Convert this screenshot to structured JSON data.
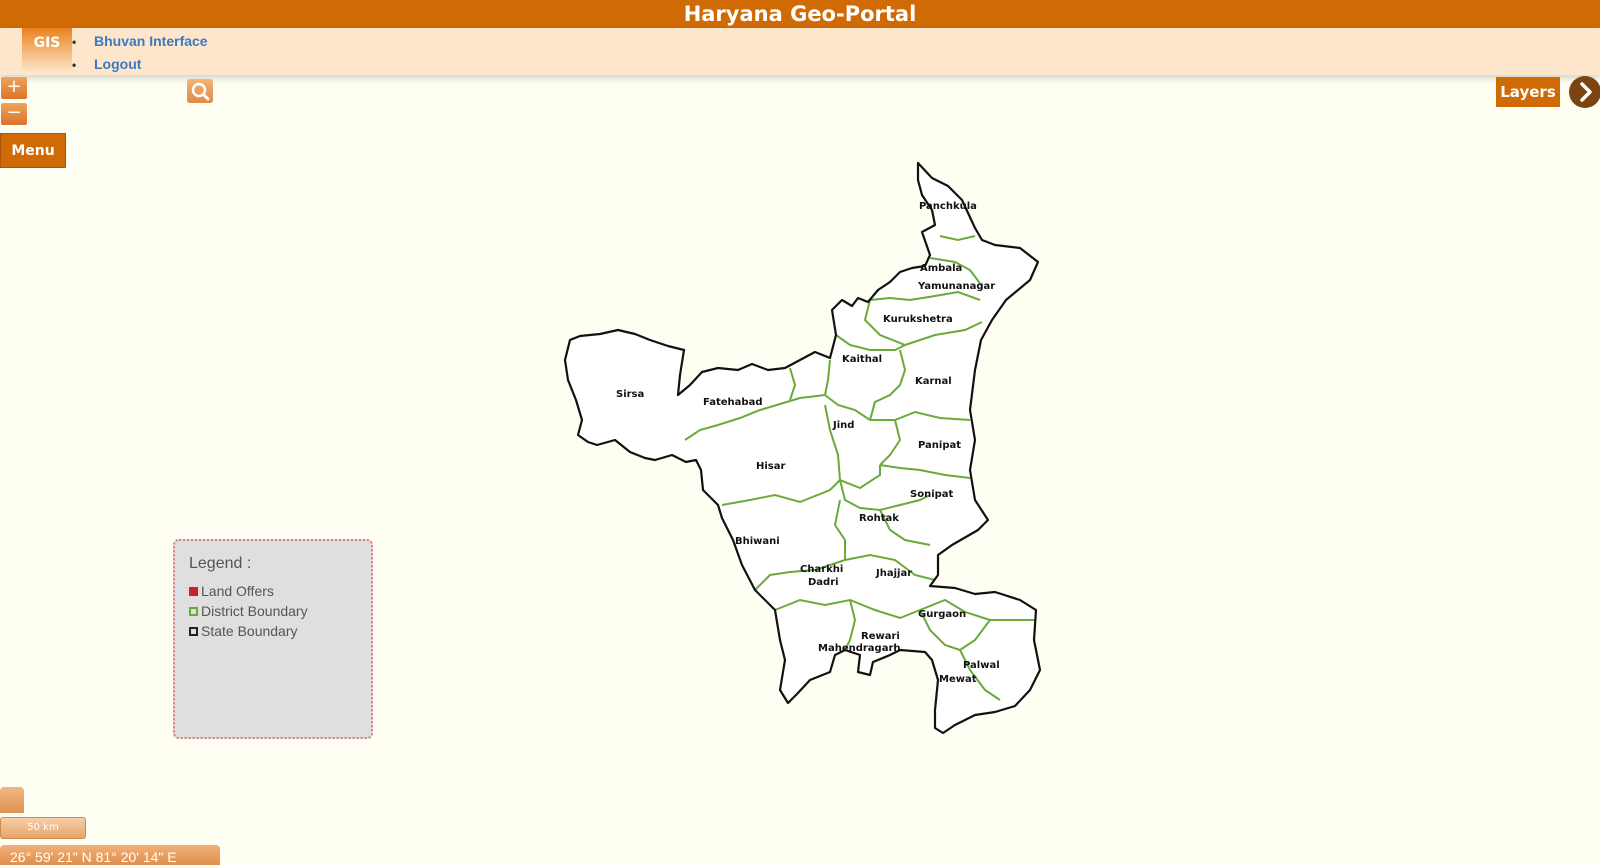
{
  "header": {
    "title": "Haryana Geo-Portal"
  },
  "nav": {
    "gis_label": "GIS",
    "links": [
      "Bhuvan Interface",
      "Logout"
    ]
  },
  "controls": {
    "zoom_in": "+",
    "zoom_out": "−",
    "menu_label": "Menu",
    "layers_label": "Layers"
  },
  "legend": {
    "title": "Legend :",
    "items": [
      {
        "label": "Land Offers",
        "color": "#cc2222"
      },
      {
        "label": "District Boundary",
        "color": "#6aaa3a"
      },
      {
        "label": "State Boundary",
        "color": "#222222"
      }
    ]
  },
  "scale": {
    "label": "50 km"
  },
  "coordinates": {
    "text": "26° 59' 21\" N 81° 20' 14\" E"
  },
  "map": {
    "districts": [
      "Panchkula",
      "Ambala",
      "Yamunanagar",
      "Kurukshetra",
      "Kaithal",
      "Karnal",
      "Sirsa",
      "Fatehabad",
      "Jind",
      "Panipat",
      "Hisar",
      "Sonipat",
      "Rohtak",
      "Bhiwani",
      "Charkhi",
      "Dadri",
      "Jhajjar",
      "Gurgaon",
      "Rewari",
      "Mahendragarh",
      "Palwal",
      "Mewat"
    ]
  }
}
